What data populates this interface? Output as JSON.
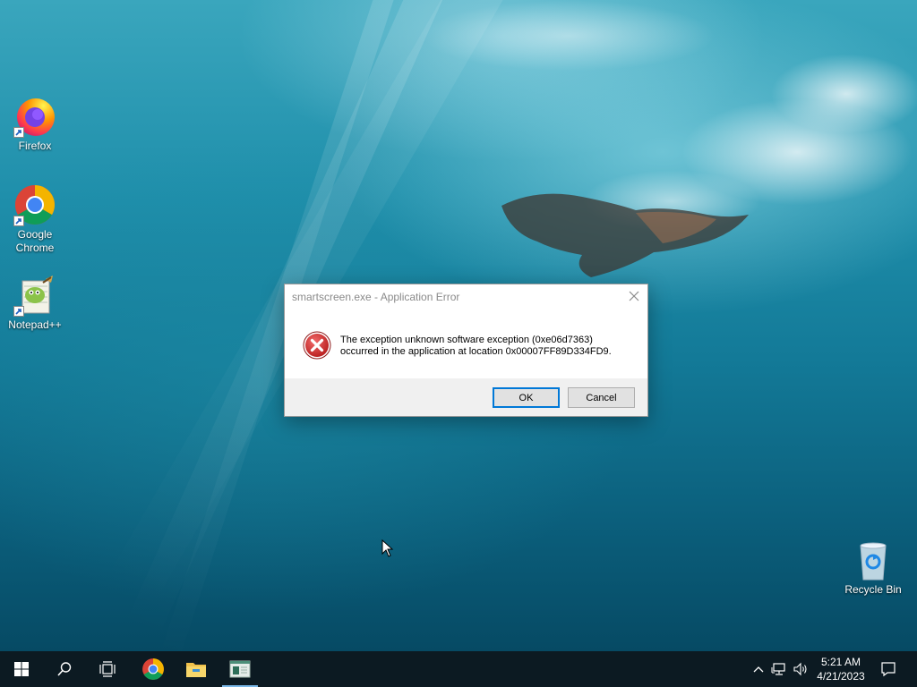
{
  "desktop": {
    "icons": [
      {
        "label": "Firefox"
      },
      {
        "label": "Google Chrome"
      },
      {
        "label": "Notepad++"
      },
      {
        "label": "Recycle Bin"
      }
    ]
  },
  "dialog": {
    "title": "smartscreen.exe - Application Error",
    "message_line1": "The exception unknown software exception (0xe06d7363)",
    "message_line2": "occurred in the application at location 0x00007FF89D334FD9.",
    "ok_label": "OK",
    "cancel_label": "Cancel"
  },
  "taskbar": {
    "pinned": [
      "start-icon",
      "search-icon",
      "task-view-icon",
      "chrome-icon",
      "file-explorer-icon",
      "window-app-icon"
    ],
    "clock": {
      "time": "5:21 AM",
      "date": "4/21/2023"
    }
  },
  "colors": {
    "accent": "#0078d7",
    "taskbar": "#0c1a22",
    "error_red": "#c62828"
  }
}
